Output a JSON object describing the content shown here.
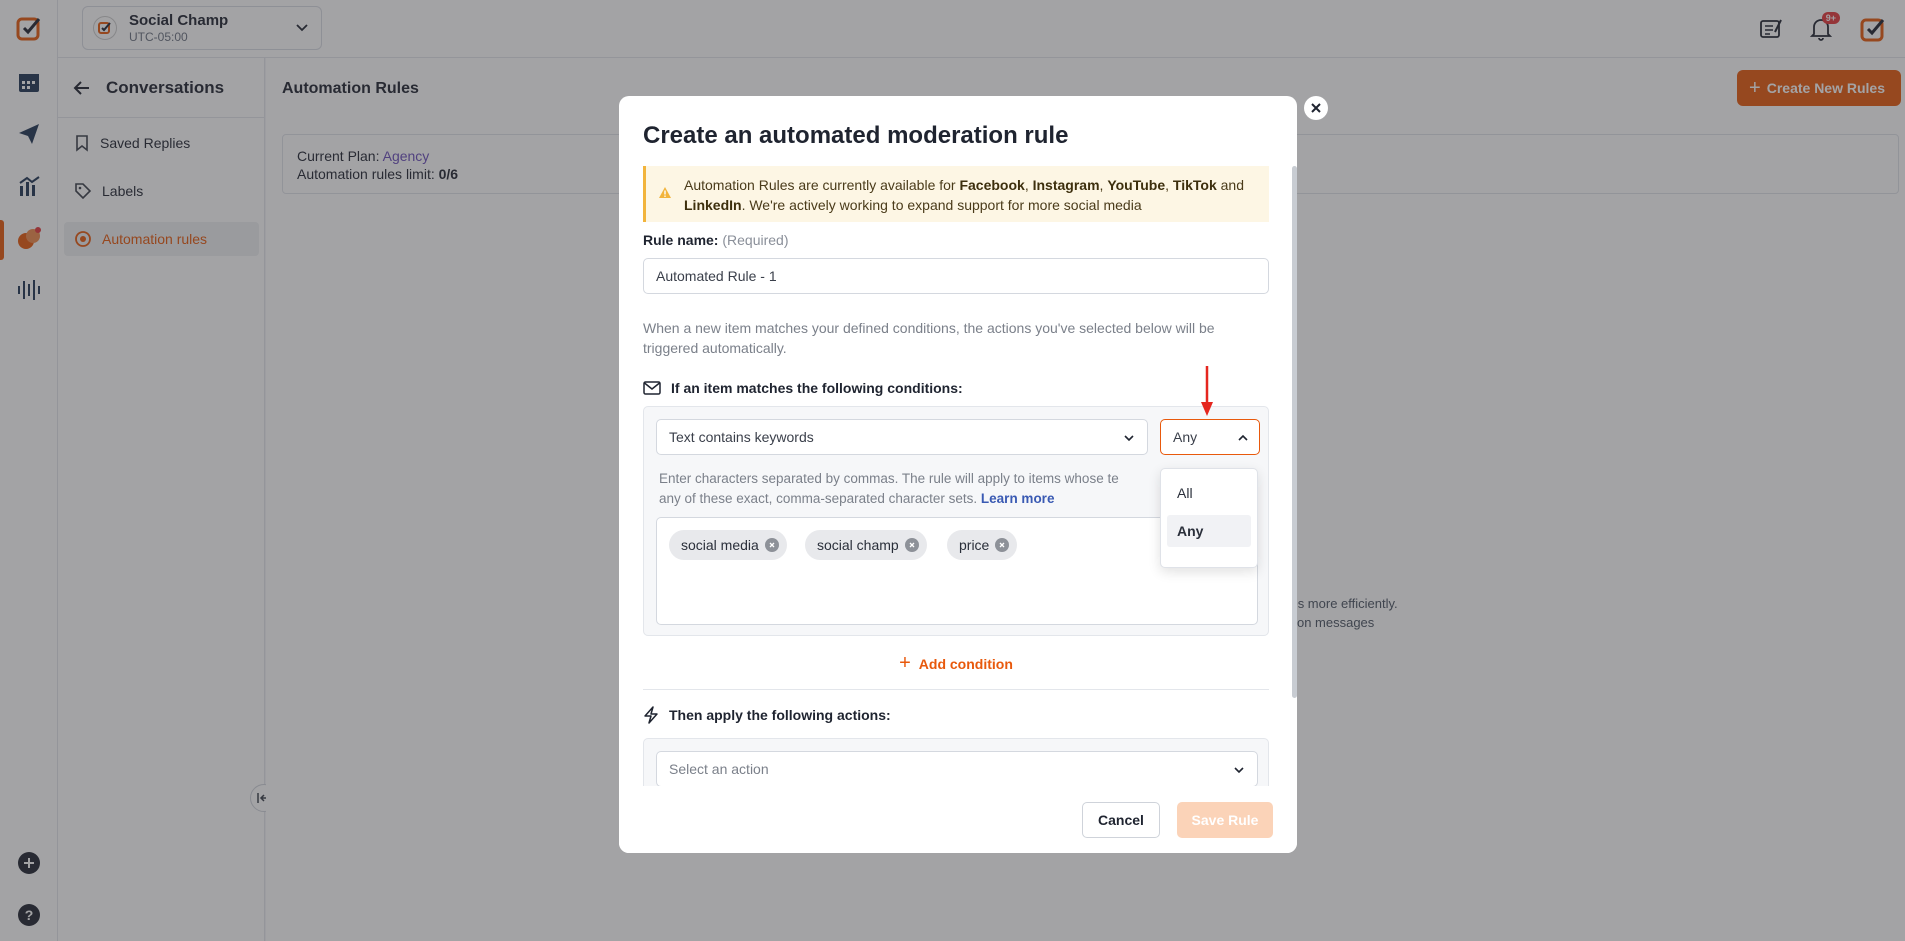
{
  "topbar": {
    "workspace_name": "Social Champ",
    "workspace_timezone": "UTC-05:00",
    "notification_count": "9+"
  },
  "subnav": {
    "title": "Conversations",
    "items": [
      {
        "label": "Saved Replies",
        "icon": "bookmark-icon"
      },
      {
        "label": "Labels",
        "icon": "tag-icon"
      },
      {
        "label": "Automation rules",
        "icon": "automation-icon",
        "active": true
      }
    ]
  },
  "main": {
    "title": "Automation Rules",
    "create_button_label": "Create New Rules",
    "plan_label": "Current Plan:",
    "plan_value": "Agency",
    "limit_label": "Automation rules limit:",
    "limit_value": "0/6",
    "empty_line1": "ages more efficiently.",
    "empty_line2": "ion on messages"
  },
  "modal": {
    "title": "Create an automated moderation rule",
    "alert": {
      "prefix": "Automation Rules are currently available for ",
      "platforms": [
        "Facebook",
        "Instagram",
        "YouTube",
        "TikTok",
        "LinkedIn"
      ],
      "sep1": ", ",
      "and": " and ",
      "suffix": ". We're actively working to expand support for more social media"
    },
    "rule_name_label": "Rule name:",
    "rule_name_required": "(Required)",
    "rule_name_value": "Automated Rule - 1",
    "description": "When a new item matches your defined conditions, the actions you've selected below will be triggered automatically.",
    "conditions_heading": "If an item matches the following conditions:",
    "condition_type": "Text contains keywords",
    "match_mode": "Any",
    "match_options": [
      {
        "label": "All",
        "selected": false
      },
      {
        "label": "Any",
        "selected": true
      }
    ],
    "help_text_line1": "Enter characters separated by commas. The rule will apply to items whose te",
    "help_text_line2": "any of these exact, comma-separated character sets.",
    "learn_more": "Learn more",
    "keywords": [
      "social media",
      "social champ",
      "price"
    ],
    "add_condition_label": "Add condition",
    "actions_heading": "Then apply the following actions:",
    "action_placeholder": "Select an action",
    "cancel_label": "Cancel",
    "save_label": "Save Rule"
  },
  "colors": {
    "accent": "#e8590c",
    "alert_bg": "#fdf6e4",
    "alert_border": "#f2b43c",
    "plan_text": "#6a4dbb",
    "annotation_arrow": "#e5261f"
  }
}
